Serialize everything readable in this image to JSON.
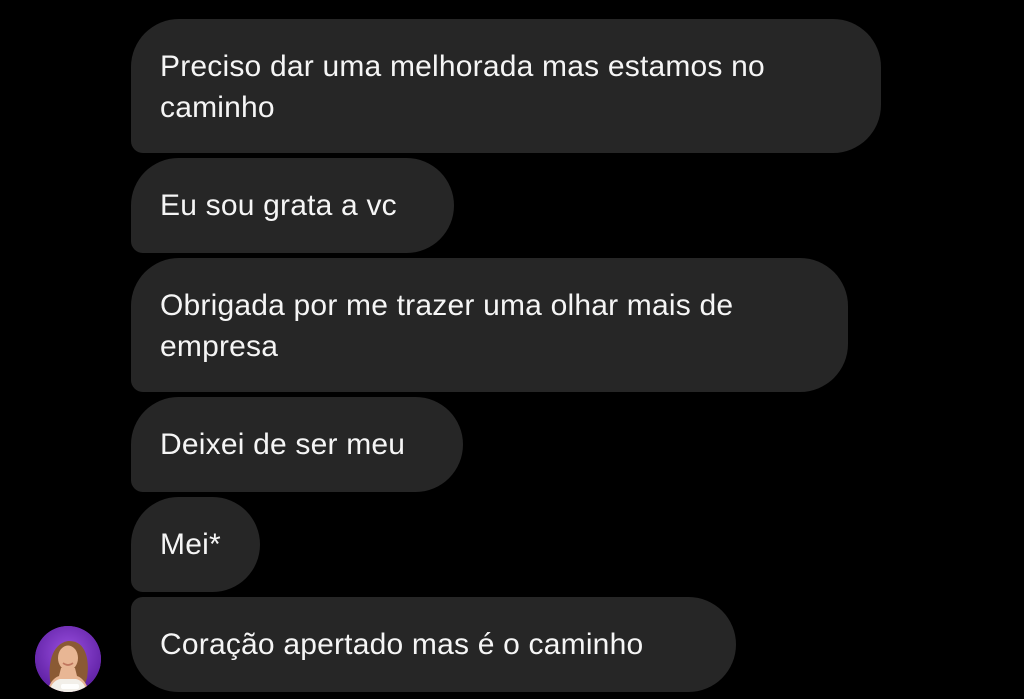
{
  "messages": [
    {
      "lines": [
        "Preciso dar uma melhorada mas estamos no",
        "caminho"
      ]
    },
    {
      "lines": [
        "Eu sou grata a vc"
      ]
    },
    {
      "lines": [
        "Obrigada por me trazer uma olhar mais de",
        "empresa"
      ]
    },
    {
      "lines": [
        "Deixei de ser meu"
      ]
    },
    {
      "lines": [
        "Mei*"
      ]
    },
    {
      "lines": [
        "Coração apertado mas é o caminho"
      ]
    }
  ],
  "colors": {
    "background": "#000000",
    "bubble": "#262626",
    "text": "#f5f5f5",
    "avatar_ring": "#7b2fc8"
  },
  "avatar": {
    "icon": "profile-photo"
  }
}
